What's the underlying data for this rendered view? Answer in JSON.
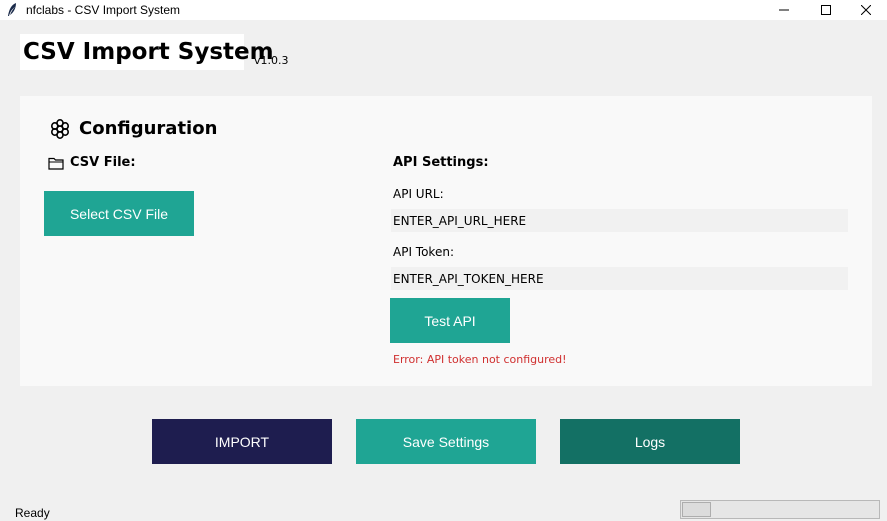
{
  "window": {
    "title": "nfclabs - CSV Import System",
    "app_icon": "feather-icon",
    "controls": [
      "minimize-icon",
      "maximize-icon",
      "close-icon"
    ]
  },
  "header": {
    "title": "CSV Import System",
    "version": "v1.0.3"
  },
  "config": {
    "title": "Configuration",
    "icon": "gear-icon",
    "csv_label": "CSV File:",
    "csv_icon": "folder-icon",
    "select_csv_button": "Select CSV File",
    "api_settings_label": "API Settings:",
    "api_url_label": "API URL:",
    "api_url_value": "ENTER_API_URL_HERE",
    "api_token_label": "API Token:",
    "api_token_value": "ENTER_API_TOKEN_HERE",
    "test_api_button": "Test API",
    "error_message": "Error: API token not configured!"
  },
  "actions": {
    "import": "IMPORT",
    "save_settings": "Save Settings",
    "logs": "Logs"
  },
  "status": {
    "text": "Ready",
    "progress": 0.15
  },
  "colors": {
    "teal": "#1fa594",
    "dark_teal": "#137064",
    "navy": "#1e1d4f",
    "error": "#d03030"
  }
}
